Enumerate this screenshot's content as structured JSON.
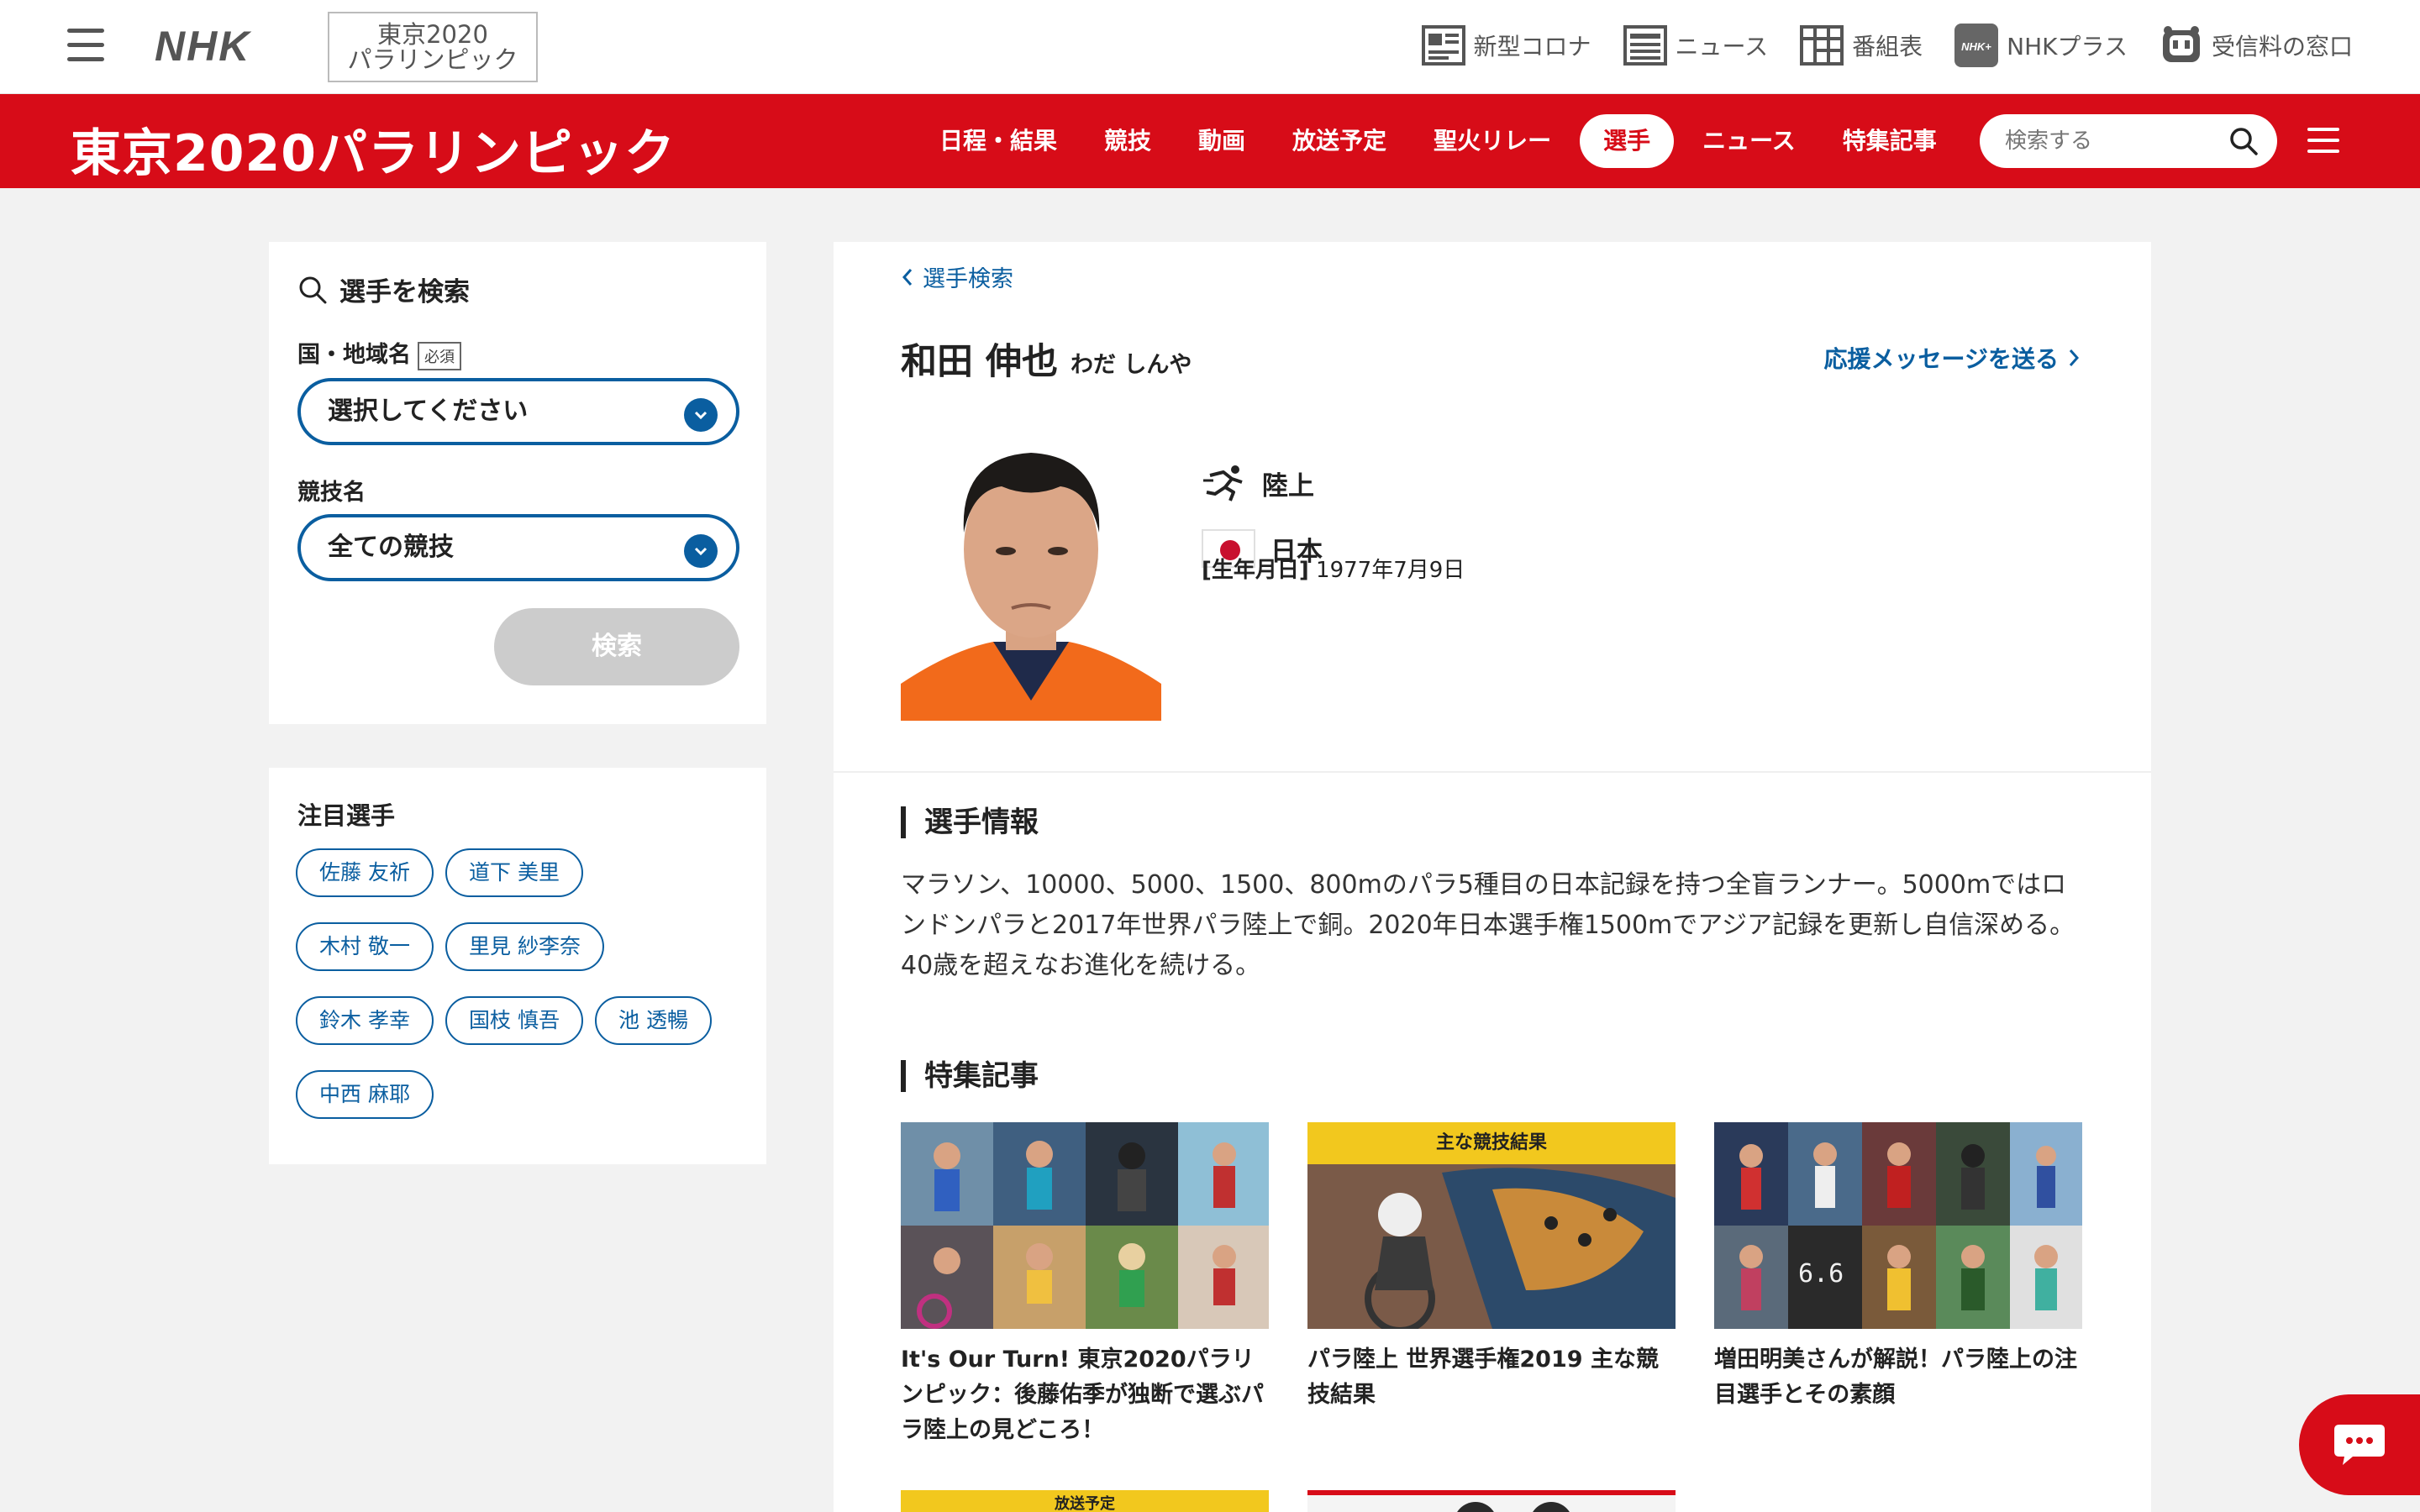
{
  "topbar": {
    "logo": "NHK",
    "badge_line1": "東京2020",
    "badge_line2": "パラリンピック",
    "links": [
      {
        "label": "新型コロナ",
        "icon": "covid-news-icon"
      },
      {
        "label": "ニュース",
        "icon": "news-icon"
      },
      {
        "label": "番組表",
        "icon": "program-guide-icon"
      },
      {
        "label": "NHKプラス",
        "icon": "nhk-plus-icon"
      },
      {
        "label": "受信料の窓口",
        "icon": "reception-fee-icon"
      }
    ]
  },
  "header": {
    "brand": "東京2020パラリンピック",
    "nav": [
      "日程・結果",
      "競技",
      "動画",
      "放送予定",
      "聖火リレー",
      "選手",
      "ニュース",
      "特集記事"
    ],
    "active_nav": "選手",
    "search_placeholder": "検索する"
  },
  "sidebar": {
    "search_title": "選手を検索",
    "country_label": "国・地域名",
    "required_badge": "必須",
    "country_value": "選択してください",
    "sport_label": "競技名",
    "sport_value": "全ての競技",
    "search_button": "検索",
    "featured_title": "注目選手",
    "featured_athletes": [
      "佐藤 友祈",
      "道下 美里",
      "木村 敬一",
      "里見 紗李奈",
      "鈴木 孝幸",
      "国枝 慎吾",
      "池 透暢",
      "中西 麻耶"
    ]
  },
  "athlete": {
    "back_link": "選手検索",
    "name": "和田 伸也",
    "kana": "わだ しんや",
    "cheer_link": "応援メッセージを送る",
    "sport": "陸上",
    "country": "日本",
    "birth_label": "[生年月日]",
    "birth_date": "1977年7月9日"
  },
  "profile": {
    "heading": "選手情報",
    "bio": "マラソン、10000、5000、1500、800mのパラ5種目の日本記録を持つ全盲ランナー。5000mではロンドンパラと2017年世界パラ陸上で銅。2020年日本選手権1500mでアジア記録を更新し自信深める。40歳を超えなお進化を続ける。"
  },
  "features": {
    "heading": "特集記事",
    "cards": [
      {
        "title": "It's Our Turn! 東京2020パラリンピック：後藤佑季が独断で選ぶパラ陸上の見どころ！",
        "banner": ""
      },
      {
        "title": "パラ陸上 世界選手権2019 主な競技結果",
        "banner": "主な競技結果"
      },
      {
        "title": "増田明美さんが解説！パラ陸上の注目選手とその素顔",
        "banner": ""
      }
    ],
    "partial_banner": "放送予定"
  },
  "colors": {
    "brand_red": "#d70c18",
    "link_blue": "#0a5ea0"
  }
}
